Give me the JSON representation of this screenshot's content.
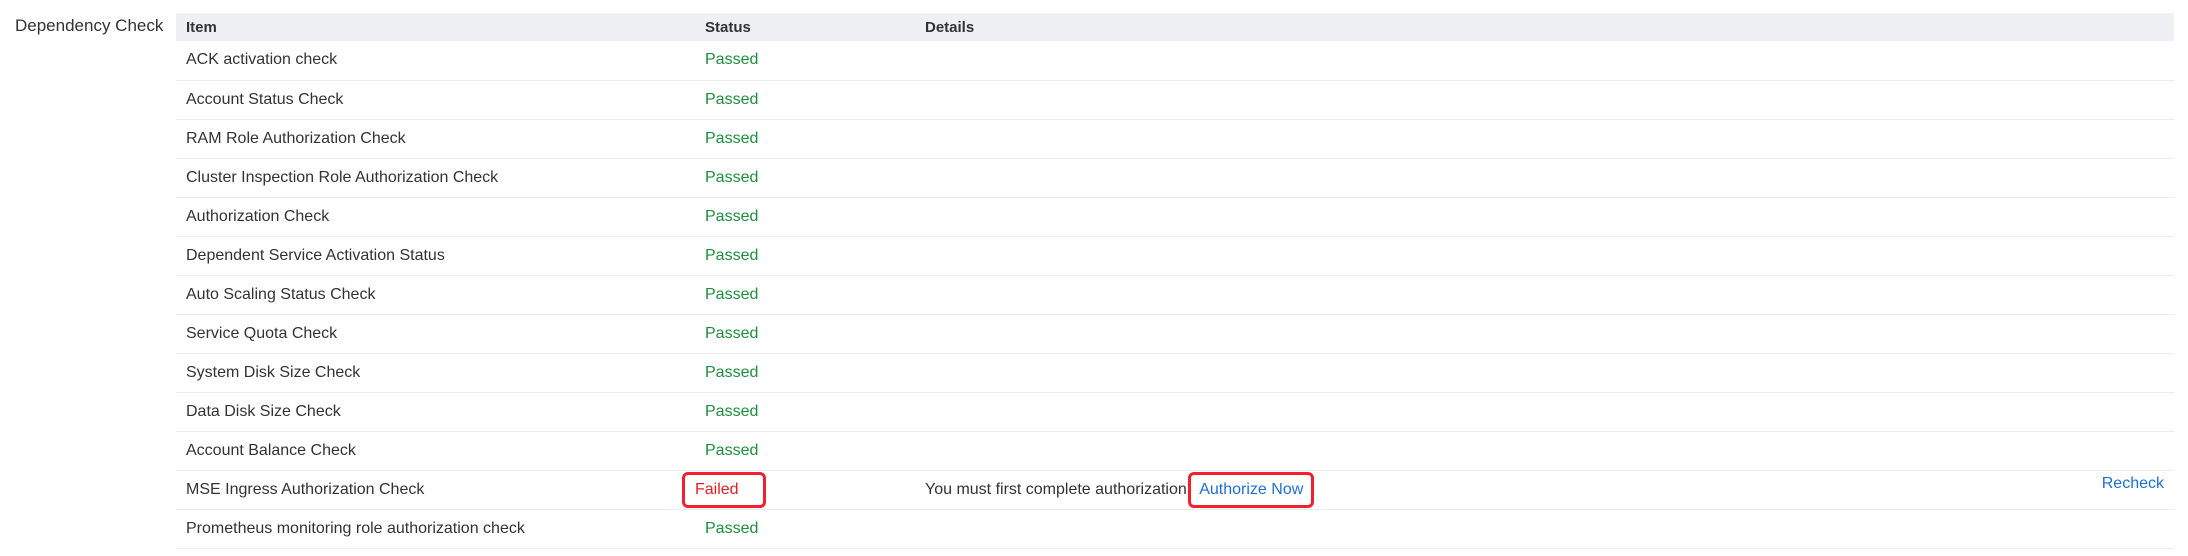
{
  "section_label": "Dependency Check",
  "columns": [
    "Item",
    "Status",
    "Details"
  ],
  "rows": [
    {
      "item": "ACK activation check",
      "status": "Passed"
    },
    {
      "item": "Account Status Check",
      "status": "Passed"
    },
    {
      "item": "RAM Role Authorization Check",
      "status": "Passed"
    },
    {
      "item": "Cluster Inspection Role Authorization Check",
      "status": "Passed"
    },
    {
      "item": "Authorization Check",
      "status": "Passed"
    },
    {
      "item": "Dependent Service Activation Status",
      "status": "Passed"
    },
    {
      "item": "Auto Scaling Status Check",
      "status": "Passed"
    },
    {
      "item": "Service Quota Check",
      "status": "Passed"
    },
    {
      "item": "System Disk Size Check",
      "status": "Passed"
    },
    {
      "item": "Data Disk Size Check",
      "status": "Passed"
    },
    {
      "item": "Account Balance Check",
      "status": "Passed"
    },
    {
      "item": "MSE Ingress Authorization Check",
      "status": "Failed",
      "details": "You must first complete authorization.",
      "link": "Authorize Now",
      "action": "Recheck"
    },
    {
      "item": "Prometheus monitoring role authorization check",
      "status": "Passed"
    }
  ],
  "colors": {
    "passed": "#1e8e3e",
    "failed": "#e02020",
    "link": "#1f6fd1",
    "highlight": "#f02030"
  }
}
